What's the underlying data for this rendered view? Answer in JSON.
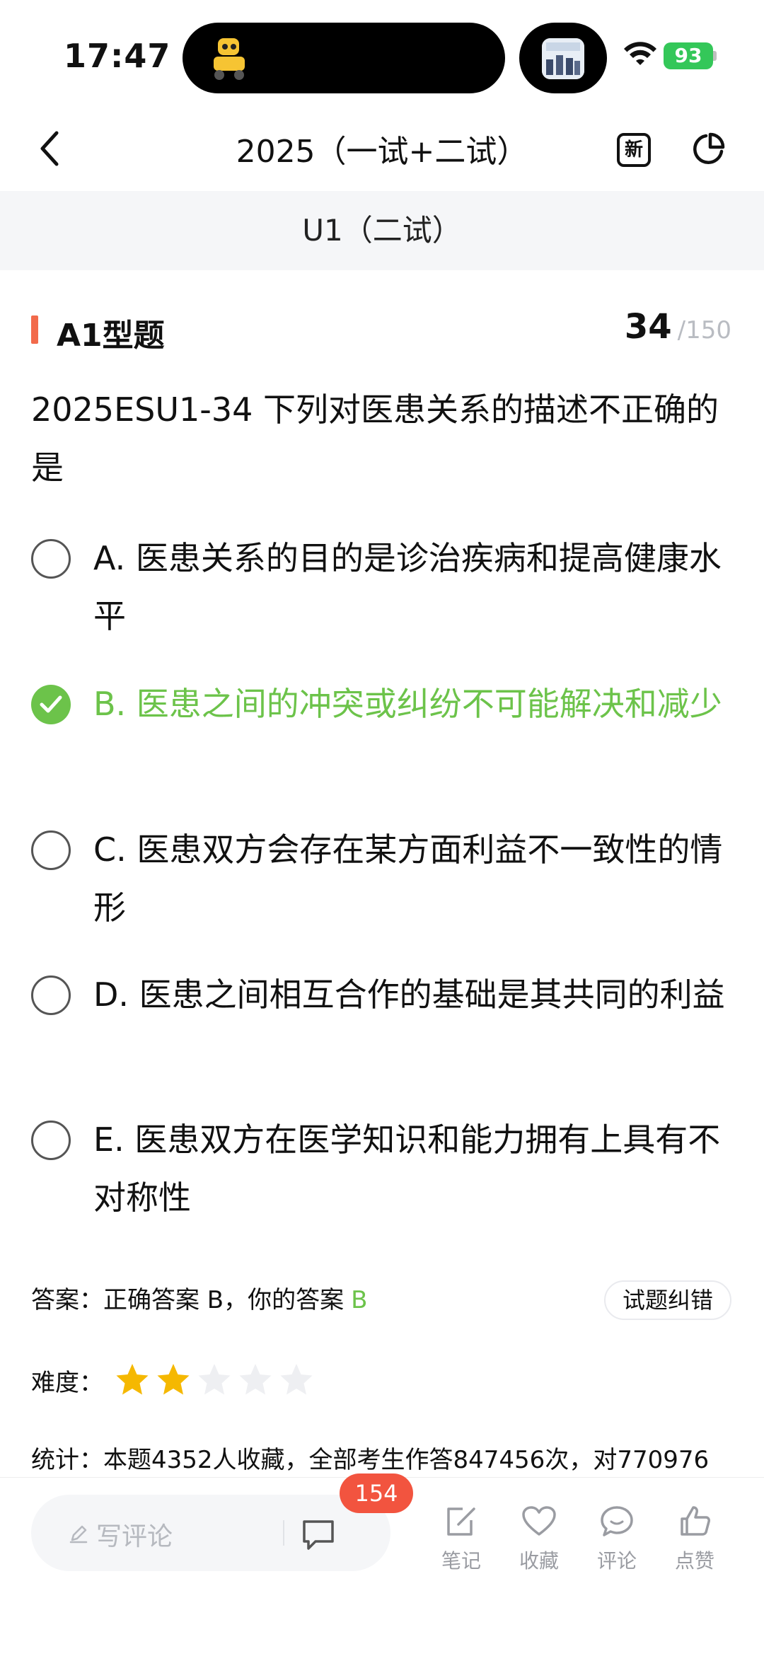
{
  "status_bar": {
    "time": "17:47",
    "battery": "93"
  },
  "nav": {
    "title": "2025（一试+二试）",
    "new_icon_label": "新"
  },
  "subheader": "U1（二试）",
  "question": {
    "type_label": "A1型题",
    "current": "34",
    "total": "/150",
    "stem": "2025ESU1-34 下列对医患关系的描述不正确的是",
    "options": [
      {
        "text": "A. 医患关系的目的是诊治疾病和提高健康水平",
        "selected": false
      },
      {
        "text": "B. 医患之间的冲突或纠纷不可能解决和减少",
        "selected": true
      },
      {
        "text": "C. 医患双方会存在某方面利益不一致性的情形",
        "selected": false
      },
      {
        "text": "D. 医患之间相互合作的基础是其共同的利益",
        "selected": false
      },
      {
        "text": "E. 医患双方在医学知识和能力拥有上具有不对称性",
        "selected": false
      }
    ]
  },
  "answer": {
    "prefix": "答案：",
    "correct_text": "正确答案 B，你的答案",
    "mine": "B",
    "report_label": "试题纠错"
  },
  "difficulty": {
    "label": "难度：",
    "rating": 2,
    "max": 5
  },
  "stats": {
    "label": "统计：",
    "text": "本题4352人收藏，全部考生作答847456次，对770976"
  },
  "bottom_bar": {
    "comment_placeholder": "写评论",
    "comment_count": "154",
    "actions": [
      {
        "label": "笔记",
        "icon": "note-icon"
      },
      {
        "label": "收藏",
        "icon": "heart-icon"
      },
      {
        "label": "评论",
        "icon": "comment-bubble-icon"
      },
      {
        "label": "点赞",
        "icon": "thumbs-up-icon"
      }
    ]
  },
  "colors": {
    "accent_red": "#f26a4b",
    "correct_green": "#6cc34a",
    "badge_red": "#f2543f",
    "star_gold": "#f5b800",
    "star_empty": "#eeeff2"
  }
}
